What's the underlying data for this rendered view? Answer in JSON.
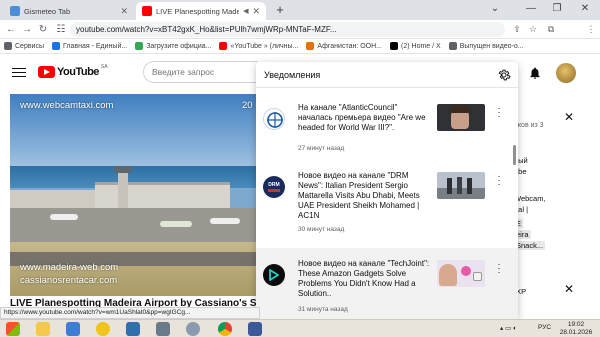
{
  "browser": {
    "tabs": [
      {
        "title": "Gismeteo Tab",
        "favicon_color": "#4a90d9"
      },
      {
        "title": "LIVE Planespotting Madeira ·",
        "favicon_color": "#ff0000"
      }
    ],
    "new_tab_label": "+",
    "url": "youtube.com/watch?v=xBT42gxK_Ho&list=PUlh7wmjWRp-MNTaF-MZF...",
    "bookmarks": [
      {
        "label": "Сервисы",
        "color": "#5f6368"
      },
      {
        "label": "Главная - Единый...",
        "color": "#1a73e8"
      },
      {
        "label": "Загрузите официа...",
        "color": "#34a853"
      },
      {
        "label": "«YouTube » (личны...",
        "color": "#ff0000"
      },
      {
        "label": "Афганистан: ООН...",
        "color": "#e37400"
      },
      {
        "label": "(2) Home / X",
        "color": "#000000"
      },
      {
        "label": "Выпущен видео-о...",
        "color": "#5f6368"
      }
    ]
  },
  "youtube": {
    "logo_text": "YouTube",
    "country_code": "SA",
    "search_placeholder": "Введите запрос",
    "video_title": "LIVE Planespotting Madeira Airport by Cassiano's S...",
    "watermarks": {
      "top_left": "www.webcamtaxi.com",
      "top_right": "20",
      "bottom_1": "www.madeira-web.com",
      "bottom_2": "cassianosrentacar.com"
    },
    "right_column": {
      "line1": "иков из 3",
      "line2": "ный",
      "line3": "ube",
      "line4": "Webcam,",
      "line5": "gal |",
      "line6": "E",
      "line7": "eira",
      "line8": "Snack...",
      "line9": "IXP"
    }
  },
  "notifications": {
    "title": "Уведомления",
    "items": [
      {
        "text": "На канале \"AtlanticCouncil\" началась премьера видео \"Are we headed for World War III?\".",
        "time": "27 минут назад",
        "channel_color": "#1c5aa6",
        "thumb_color": "#3a3a3a"
      },
      {
        "text": "Новое видео на канале \"DRM News\": Italian President Sergio Mattarella Visits Abu Dhabi, Meets UAE President Sheikh Mohamed | AC1N",
        "time": "30 минут назад",
        "channel_color": "#1a2a5a",
        "thumb_color": "#8c97a8"
      },
      {
        "text": "Новое видео на канале \"TechJoint\": These Amazon Gadgets Solve Problems You Didn't Know Had a Solution..",
        "time": "31 минута назад",
        "channel_color": "#0b0b0b",
        "thumb_color": "#e0d6e8"
      }
    ]
  },
  "status_url": "https://www.youtube.com/watch?v=wm1UaShlat0&pp=wgIGCg...",
  "taskbar": {
    "lang": "РУС",
    "time": "19:02",
    "date": "28.01.2026"
  }
}
